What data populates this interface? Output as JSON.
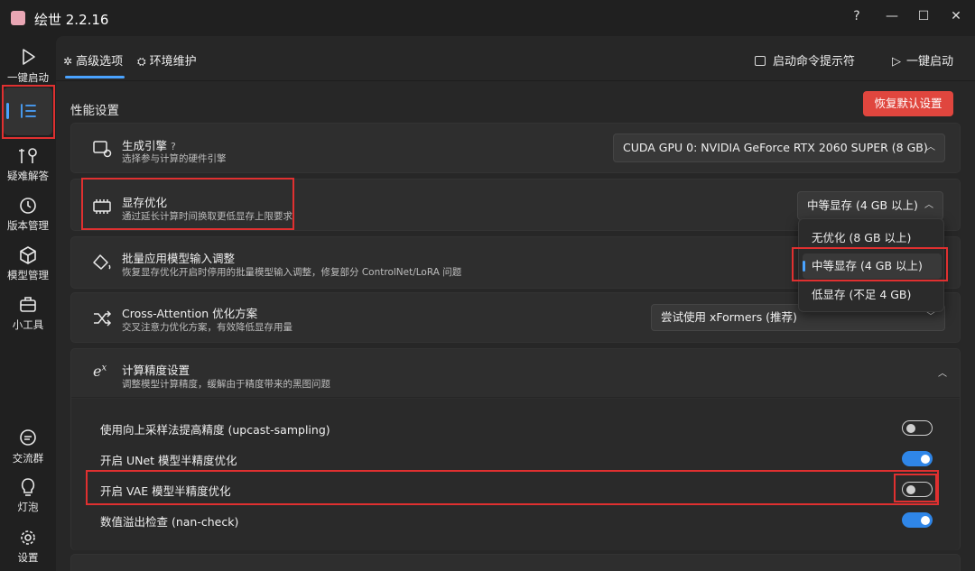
{
  "app": {
    "title": "绘世 2.2.16"
  },
  "window_controls": {
    "help": "?",
    "minimize": "—",
    "maximize": "☐",
    "close": "✕"
  },
  "sidebar": {
    "items": [
      {
        "label": "一键启动",
        "icon": "play-icon"
      },
      {
        "label": "",
        "icon": "list-icon"
      },
      {
        "label": "疑难解答",
        "icon": "tools-icon"
      },
      {
        "label": "版本管理",
        "icon": "history-icon"
      },
      {
        "label": "模型管理",
        "icon": "cube-icon"
      },
      {
        "label": "小工具",
        "icon": "toolbox-icon"
      },
      {
        "label": "交流群",
        "icon": "chat-icon"
      },
      {
        "label": "灯泡",
        "icon": "bulb-icon"
      },
      {
        "label": "设置",
        "icon": "gear-icon"
      }
    ]
  },
  "tabs": [
    {
      "label": "高级选项",
      "icon": "gear-icon"
    },
    {
      "label": "环境维护",
      "icon": "maintenance-icon"
    }
  ],
  "header_actions": {
    "console": "启动命令提示符",
    "launch": "一键启动"
  },
  "section": {
    "title": "性能设置",
    "reset_label": "恢复默认设置"
  },
  "cards": [
    {
      "title": "生成引擎",
      "help": "?",
      "desc": "选择参与计算的硬件引擎",
      "value": "CUDA GPU 0: NVIDIA GeForce RTX 2060 SUPER (8 GB)"
    },
    {
      "title": "显存优化",
      "desc": "通过延长计算时间换取更低显存上限要求",
      "value": "中等显存 (4 GB 以上)"
    },
    {
      "title": "批量应用模型输入调整",
      "desc": "恢复显存优化开启时停用的批量模型输入调整，修复部分 ControlNet/LoRA 问题"
    },
    {
      "title": "Cross-Attention 优化方案",
      "desc": "交叉注意力优化方案，有效降低显存用量",
      "value": "尝试使用 xFormers (推荐)"
    },
    {
      "title": "计算精度设置",
      "desc": "调整模型计算精度，缓解由于精度带来的黑图问题"
    }
  ],
  "dropdown_options": [
    {
      "label": "无优化 (8 GB 以上)",
      "selected": false
    },
    {
      "label": "中等显存 (4 GB 以上)",
      "selected": true
    },
    {
      "label": "低显存 (不足 4 GB)",
      "selected": false
    }
  ],
  "precision_options": [
    {
      "label": "使用向上采样法提高精度 (upcast-sampling)",
      "on": false
    },
    {
      "label": "开启 UNet 模型半精度优化",
      "on": true
    },
    {
      "label": "开启 VAE 模型半精度优化",
      "on": false
    },
    {
      "label": "数值溢出检查 (nan-check)",
      "on": true
    }
  ],
  "colors": {
    "accent": "#2f86e8",
    "danger": "#e0463e",
    "annotation": "#e03030"
  }
}
